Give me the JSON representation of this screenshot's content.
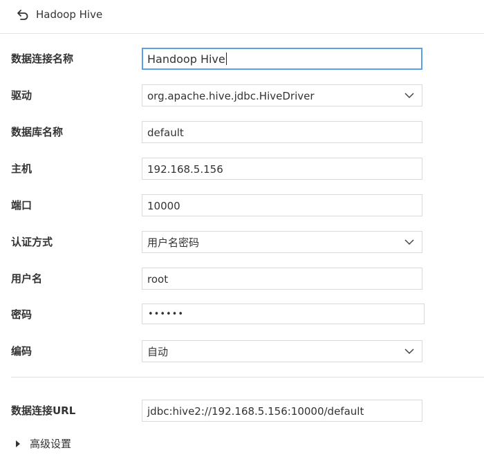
{
  "header": {
    "title": "Hadoop Hive",
    "back_icon": "back-arrow-icon"
  },
  "form": {
    "connection_name": {
      "label": "数据连接名称",
      "value": "Handoop Hive"
    },
    "driver": {
      "label": "驱动",
      "value": "org.apache.hive.jdbc.HiveDriver"
    },
    "database_name": {
      "label": "数据库名称",
      "value": "default"
    },
    "host": {
      "label": "主机",
      "value": "192.168.5.156"
    },
    "port": {
      "label": "端口",
      "value": "10000"
    },
    "auth_method": {
      "label": "认证方式",
      "value": "用户名密码"
    },
    "username": {
      "label": "用户名",
      "value": "root"
    },
    "password": {
      "label": "密码",
      "value": "••••••"
    },
    "encoding": {
      "label": "编码",
      "value": "自动"
    },
    "url": {
      "label": "数据连接URL",
      "value": "jdbc:hive2://192.168.5.156:10000/default"
    }
  },
  "advanced": {
    "label": "高级设置"
  },
  "colors": {
    "focus_border": "#5aa0e8",
    "border": "#d9d9d9",
    "divider": "#e3e3e3"
  }
}
